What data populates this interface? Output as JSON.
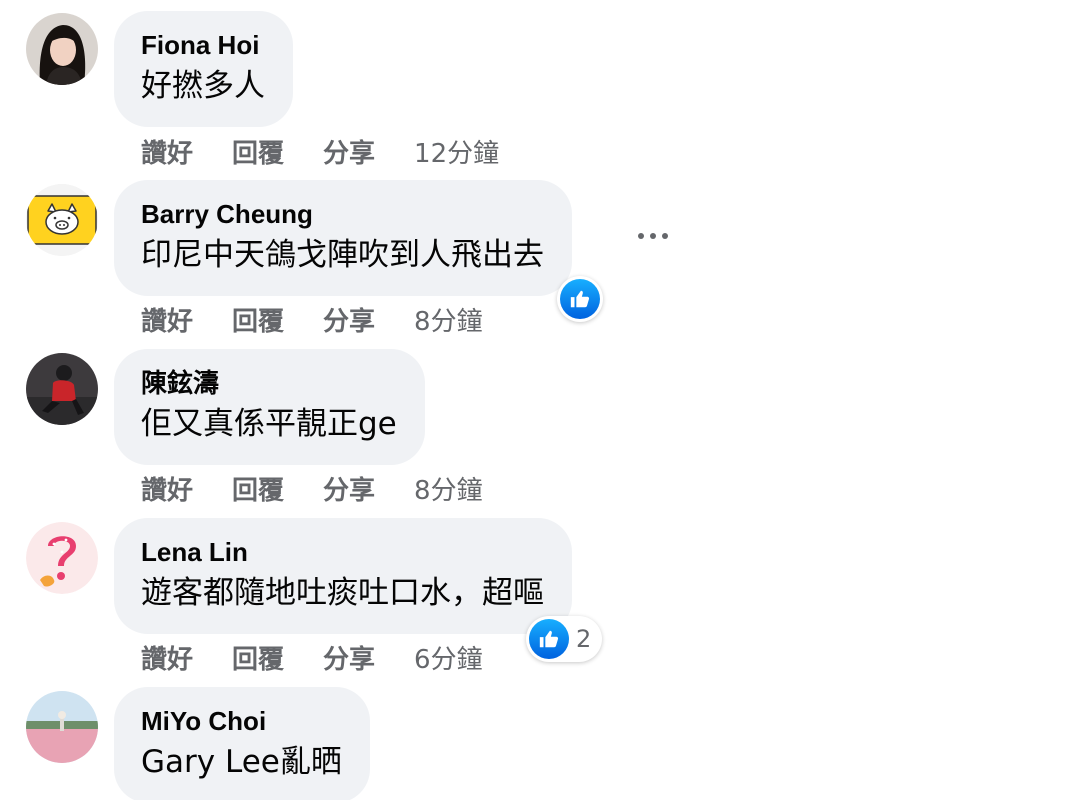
{
  "comments": [
    {
      "author": "Fiona Hoi",
      "text": "好撚多人",
      "actions": {
        "like": "讚好",
        "reply": "回覆",
        "share": "分享"
      },
      "time": "12分鐘",
      "avatar": "woman-portrait-avatar"
    },
    {
      "author": "Barry Cheung",
      "text": "印尼中天鴿戈陣吹到人飛出去",
      "actions": {
        "like": "讚好",
        "reply": "回覆",
        "share": "分享"
      },
      "time": "8分鐘",
      "avatar": "yellow-pig-avatar",
      "reaction": {
        "icon": "like-icon",
        "count": ""
      },
      "more_icon": "more-options-icon"
    },
    {
      "author": "陳鉉濤",
      "text": "佢又真係平靚正ge",
      "actions": {
        "like": "讚好",
        "reply": "回覆",
        "share": "分享"
      },
      "time": "8分鐘",
      "avatar": "person-red-jacket-avatar"
    },
    {
      "author": "Lena Lin",
      "text": "遊客都隨地吐痰吐口水，超嘔",
      "actions": {
        "like": "讚好",
        "reply": "回覆",
        "share": "分享"
      },
      "time": "6分鐘",
      "avatar": "pink-question-mark-avatar",
      "reaction": {
        "icon": "like-icon",
        "count": "2"
      }
    },
    {
      "author": "MiYo Choi",
      "text": "Gary Lee亂晒",
      "avatar": "pink-field-avatar"
    }
  ],
  "colors": {
    "bubble": "#f0f2f5",
    "action_text": "#65676b",
    "like_blue": "#1877f2"
  }
}
